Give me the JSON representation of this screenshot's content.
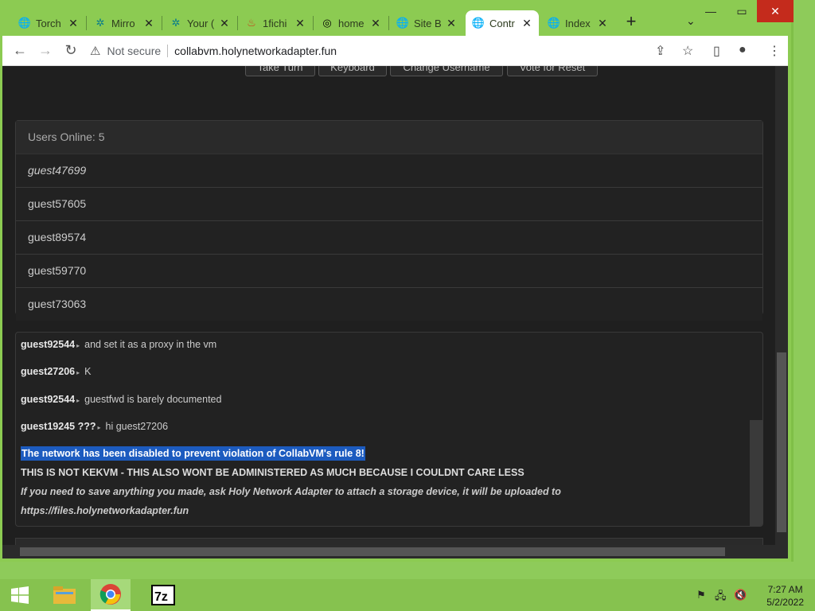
{
  "browser": {
    "tabs": [
      {
        "title": "Torch",
        "icon": "globe-icon"
      },
      {
        "title": "Mirro",
        "icon": "openai-icon"
      },
      {
        "title": "Your (",
        "icon": "openai-icon"
      },
      {
        "title": "1fichi",
        "icon": "fire-icon"
      },
      {
        "title": "home",
        "icon": "spiral-icon"
      },
      {
        "title": "Site B",
        "icon": "globe-icon"
      },
      {
        "title": "Contr",
        "icon": "globe-icon",
        "active": true
      },
      {
        "title": "Index",
        "icon": "globe-icon"
      }
    ],
    "address": {
      "security": "Not secure",
      "url": "collabvm.holynetworkadapter.fun"
    }
  },
  "vm_controls": {
    "buttons": [
      "Take Turn",
      "Keyboard",
      "Change Username",
      "Vote for Reset"
    ]
  },
  "users": {
    "header": "Users Online: 5",
    "list": [
      "guest47699",
      "guest57605",
      "guest89574",
      "guest59770",
      "guest73063"
    ]
  },
  "chat": {
    "messages": [
      {
        "user": "guest92544",
        "text": "and set it as a proxy in the vm"
      },
      {
        "user": "guest27206",
        "text": "K"
      },
      {
        "user": "guest92544",
        "text": "guestfwd is barely documented"
      },
      {
        "user": "guest19245 ???",
        "text": "hi guest27206"
      }
    ],
    "system": [
      "The network has been disabled to prevent violation of CollabVM's rule 8!",
      "THIS IS NOT KEKVM - THIS ALSO WONT BE ADMINISTERED AS MUCH BECAUSE I COULDNT CARE LESS",
      "If you need to save anything you made, ask Holy Network Adapter to attach a storage device, it will be uploaded to",
      "https://files.holynetworkadapter.fun"
    ]
  },
  "taskbar": {
    "time": "7:27 AM",
    "date": "5/2/2022"
  }
}
